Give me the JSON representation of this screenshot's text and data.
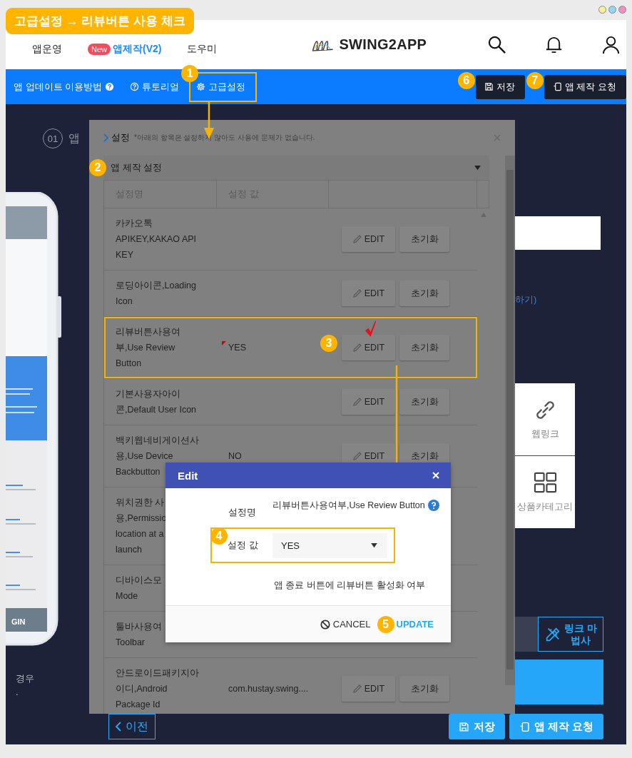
{
  "annotation": {
    "title": "고급설정 → 리뷰버튼 사용 체크"
  },
  "header": {
    "nav": [
      {
        "label": "앱운영",
        "selected": false
      },
      {
        "label": "앱제작(V2)",
        "badge": "New",
        "selected": true
      },
      {
        "label": "도우미",
        "selected": false
      }
    ],
    "logo": "SWING2APP"
  },
  "toolbar": {
    "links": [
      {
        "label": "앱 업데이트 이용방법",
        "kind": "help-after",
        "highlighted": false
      },
      {
        "label": "튜토리얼",
        "kind": "help-before",
        "highlighted": false
      },
      {
        "label": "고급설정",
        "kind": "gear",
        "highlighted": true,
        "marker": "1"
      }
    ],
    "buttons": [
      {
        "label": "저장",
        "kind": "save",
        "marker": "6"
      },
      {
        "label": "앱 제작 요청",
        "kind": "device",
        "marker": "7"
      }
    ]
  },
  "background": {
    "step": {
      "number": "01",
      "label": "앱"
    },
    "preview_button": "GIN",
    "side_text": [
      "경우",
      "."
    ],
    "link_text": "하기)",
    "tiles": [
      {
        "label": "웹링크",
        "kind": "link"
      },
      {
        "label": "상품카테고리",
        "kind": "grid"
      }
    ],
    "wizard": "링크 마법사",
    "bottom_buttons": [
      {
        "label": "이전",
        "kind": "back"
      },
      {
        "label": "저장",
        "kind": "save"
      },
      {
        "label": "앱 제작 요청",
        "kind": "device"
      }
    ]
  },
  "panel": {
    "title": "설정",
    "note": "*아래의 항목은 설정하지 않아도 사용에 문제가 없습니다.",
    "section": "앱 제작 설정",
    "section_marker": "2",
    "columns": [
      "설정명",
      "설정 값"
    ],
    "rows": [
      {
        "name_lines": [
          "카카오톡",
          "APIKEY,KAKAO API",
          "KEY"
        ],
        "actions": [
          "EDIT",
          "초기화"
        ],
        "highlighted": false
      },
      {
        "name_lines": [
          "로딩아이콘,Loading",
          "Icon"
        ],
        "actions": [
          "EDIT",
          "초기화"
        ],
        "highlighted": false
      },
      {
        "name_lines": [
          "리뷰버튼사용여",
          "부,Use Review",
          "Button"
        ],
        "value": "YES",
        "flagged": true,
        "actions": [
          "EDIT",
          "초기화"
        ],
        "highlighted": true,
        "checked": true,
        "marker": "3"
      },
      {
        "name_lines": [
          "기본사용자아이",
          "콘,Default User Icon"
        ],
        "actions": [
          "EDIT",
          "초기화"
        ],
        "highlighted": false
      },
      {
        "name_lines": [
          "백키웹네비게이션사",
          "용,Use Device",
          "Backbutton"
        ],
        "value": "NO",
        "actions": [
          "EDIT",
          "초기화"
        ],
        "highlighted": false
      },
      {
        "name_lines": [
          "위치권한 사",
          "용,Permissio",
          "location at a",
          "launch"
        ],
        "highlighted": false
      },
      {
        "name_lines": [
          "디바이스모",
          "Mode"
        ],
        "highlighted": false
      },
      {
        "name_lines": [
          "툴바사용여",
          "Toolbar"
        ],
        "highlighted": false
      },
      {
        "name_lines": [
          "안드로이드패키지아",
          "이디,Android",
          "Package Id"
        ],
        "value": "com.hustay.swing....",
        "actions": [
          "EDIT",
          "초기화"
        ],
        "highlighted": false
      }
    ]
  },
  "dialog": {
    "title": "Edit",
    "name_label": "설정명",
    "name_value": "리뷰버튼사용여부,Use Review Button",
    "value_label": "설정 값",
    "value": "YES",
    "value_marker": "4",
    "value_highlighted": true,
    "description": "앱 종료 버튼에 리뷰버튼 활성화 여부",
    "cancel": "CANCEL",
    "update": "UPDATE",
    "update_marker": "5"
  }
}
